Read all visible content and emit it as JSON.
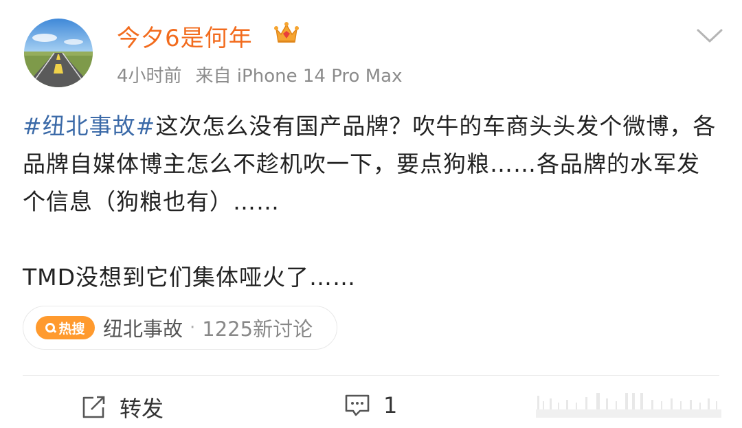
{
  "user": {
    "name": "今夕6是何年",
    "time": "4小时前",
    "source": "来自 iPhone 14 Pro Max"
  },
  "post": {
    "topic": "#纽北事故#",
    "line1": "这次怎么没有国产品牌？吹牛的车商头头发个微博，各品牌自媒体博主怎么不趁机吹一下，要点狗粮……各品牌的水军发个信息（狗粮也有）……",
    "line2": "TMD没想到它们集体哑火了……"
  },
  "hot_search": {
    "badge": "热搜",
    "topic": "纽北事故",
    "separator": "·",
    "count": "1225新讨论"
  },
  "actions": {
    "repost_label": "转发",
    "comment_count": "1"
  },
  "colors": {
    "username": "#f26b1d",
    "topic": "#3b6aa8",
    "hot_badge": "#ff9a2e"
  },
  "icons": [
    "avatar-road-image",
    "crown-icon",
    "chevron-down-icon",
    "repost-icon",
    "comment-icon"
  ]
}
